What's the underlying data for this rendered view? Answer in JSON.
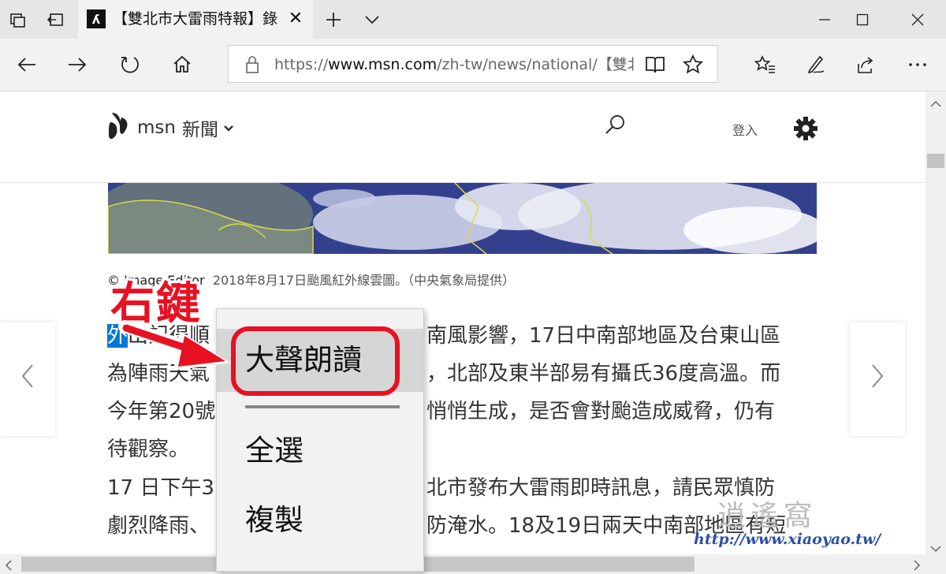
{
  "browser": {
    "tab": {
      "title": "【雙北市大雷雨特報】錄",
      "favicon_icon": "msn-butterfly-icon"
    },
    "address": {
      "prefix": "https://",
      "host": "www.msn.com",
      "path": "/zh-tw/news/national/【雙北"
    }
  },
  "site": {
    "brand": "msn",
    "section": "新聞",
    "login_label": "登入"
  },
  "article": {
    "caption_credit": "© Image Editor",
    "caption_text": "2018年8月17日颱風紅外線雲圖。（中央氣象局提供）",
    "p1": {
      "selected": "外",
      "l1_a": "出記得順",
      "l1_b": "南風影響，17日中南部地區及台東山區",
      "l2_a": "為陣雨天氣",
      "l2_b": "，北部及東半部易有攝氏36度高溫。而",
      "l3_a": "今年第20號",
      "l3_b": "悄悄生成，是否會對颱造成威脅，仍有",
      "l4": "待觀察。"
    },
    "p2": {
      "l1_a": "17 日下午3",
      "l1_b": "北市發布大雷雨即時訊息，請民眾慎防",
      "l2_a": "劇烈降雨、",
      "l2_b": "防淹水。18及19日兩天中南部地區有短"
    }
  },
  "context_menu": {
    "items": [
      {
        "label": "大聲朗讀"
      },
      {
        "label": "全選"
      },
      {
        "label": "複製"
      }
    ]
  },
  "annotation": {
    "text": "右鍵"
  },
  "watermark": {
    "chars": "逍遙窩",
    "url": "http://www.xiaoyao.tw/"
  },
  "colors": {
    "accent_red": "#e81123",
    "selection_blue": "#0078d7"
  }
}
